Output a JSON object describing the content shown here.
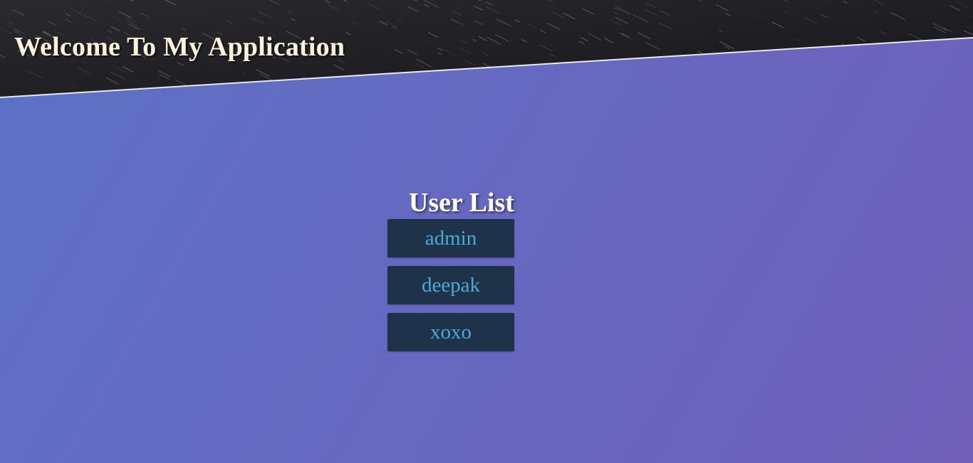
{
  "header": {
    "title": "Welcome To My Application"
  },
  "user_list": {
    "heading": "User List",
    "users": [
      "admin",
      "deepak",
      "xoxo"
    ]
  },
  "colors": {
    "background_start": "#5b72c6",
    "background_end": "#7060ba",
    "header_dark": "#1c1b1f",
    "item_background": "#1e3349",
    "item_text": "#4aa9d6",
    "title_text": "#fbf3dc"
  }
}
